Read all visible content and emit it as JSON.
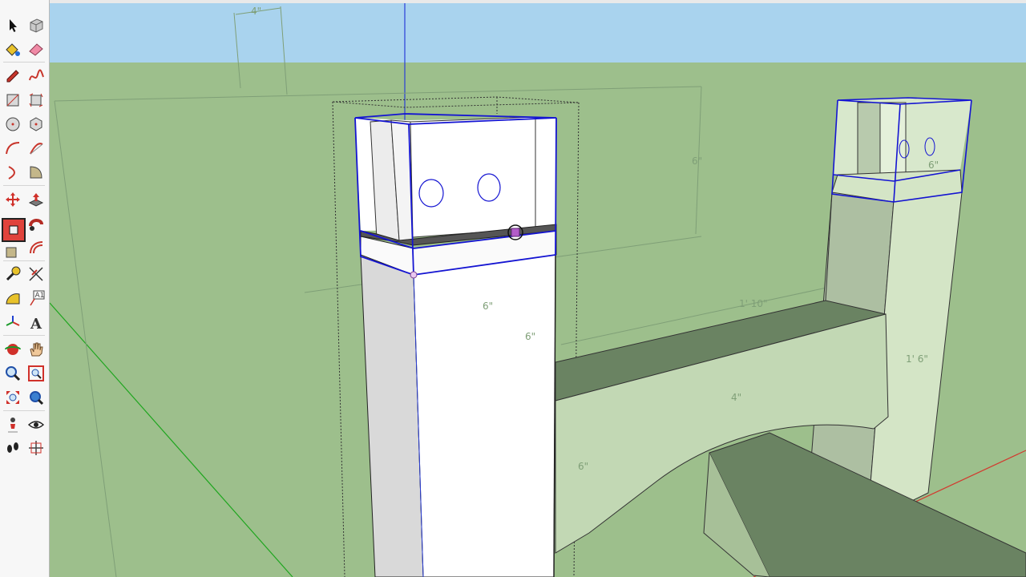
{
  "toolbar": {
    "tools": [
      {
        "id": "select",
        "icon": "arrow-icon"
      },
      {
        "id": "make-component",
        "icon": "component-icon"
      },
      {
        "id": "paint-bucket",
        "icon": "paint-bucket-icon"
      },
      {
        "id": "eraser",
        "icon": "eraser-icon"
      },
      {
        "id": "line",
        "icon": "pencil-icon"
      },
      {
        "id": "freehand",
        "icon": "freehand-icon"
      },
      {
        "id": "rectangle",
        "icon": "rectangle-icon"
      },
      {
        "id": "rotated-rectangle",
        "icon": "rotated-rectangle-icon"
      },
      {
        "id": "circle",
        "icon": "circle-icon"
      },
      {
        "id": "polygon",
        "icon": "polygon-icon"
      },
      {
        "id": "arc",
        "icon": "arc-icon"
      },
      {
        "id": "two-point-arc",
        "icon": "two-point-arc-icon"
      },
      {
        "id": "three-point-arc",
        "icon": "three-point-arc-icon"
      },
      {
        "id": "pie",
        "icon": "pie-icon"
      },
      {
        "id": "move",
        "icon": "move-icon"
      },
      {
        "id": "push-pull",
        "icon": "push-pull-icon"
      },
      {
        "id": "rotate",
        "icon": "rotate-icon"
      },
      {
        "id": "follow-me",
        "icon": "follow-me-icon"
      },
      {
        "id": "scale",
        "icon": "scale-icon"
      },
      {
        "id": "offset",
        "icon": "offset-icon"
      },
      {
        "id": "tape-measure",
        "icon": "tape-measure-icon"
      },
      {
        "id": "dimension",
        "icon": "dimension-icon"
      },
      {
        "id": "protractor",
        "icon": "protractor-icon"
      },
      {
        "id": "text",
        "icon": "text-icon",
        "label": "A1"
      },
      {
        "id": "axes",
        "icon": "axes-icon"
      },
      {
        "id": "3d-text",
        "icon": "3d-text-icon",
        "label": "A"
      },
      {
        "id": "orbit",
        "icon": "orbit-icon"
      },
      {
        "id": "pan",
        "icon": "hand-icon"
      },
      {
        "id": "zoom",
        "icon": "magnifier-icon"
      },
      {
        "id": "zoom-window",
        "icon": "zoom-window-icon"
      },
      {
        "id": "zoom-extents",
        "icon": "zoom-extents-icon"
      },
      {
        "id": "previous-view",
        "icon": "previous-view-icon"
      },
      {
        "id": "position-camera",
        "icon": "position-camera-icon"
      },
      {
        "id": "look-around",
        "icon": "eye-icon"
      },
      {
        "id": "walk",
        "icon": "footprints-icon"
      },
      {
        "id": "section-plane",
        "icon": "section-plane-icon"
      }
    ],
    "active_tool": "push-pull"
  },
  "viewport": {
    "sky_color": "#a9d3ee",
    "ground_color": "#9dbf8c",
    "selection_color": "#1414d2",
    "dimensions": [
      {
        "id": "top-width",
        "text": "4\""
      },
      {
        "id": "back-height",
        "text": "6\""
      },
      {
        "id": "post-face-width",
        "text": "6\""
      },
      {
        "id": "post-face-height",
        "text": "6\""
      },
      {
        "id": "beam-length",
        "text": "1' 10\""
      },
      {
        "id": "right-post-top",
        "text": "6\""
      },
      {
        "id": "right-post-height",
        "text": "1' 6\""
      },
      {
        "id": "arch-depth",
        "text": "4\""
      },
      {
        "id": "lower-height",
        "text": "6\""
      }
    ]
  }
}
